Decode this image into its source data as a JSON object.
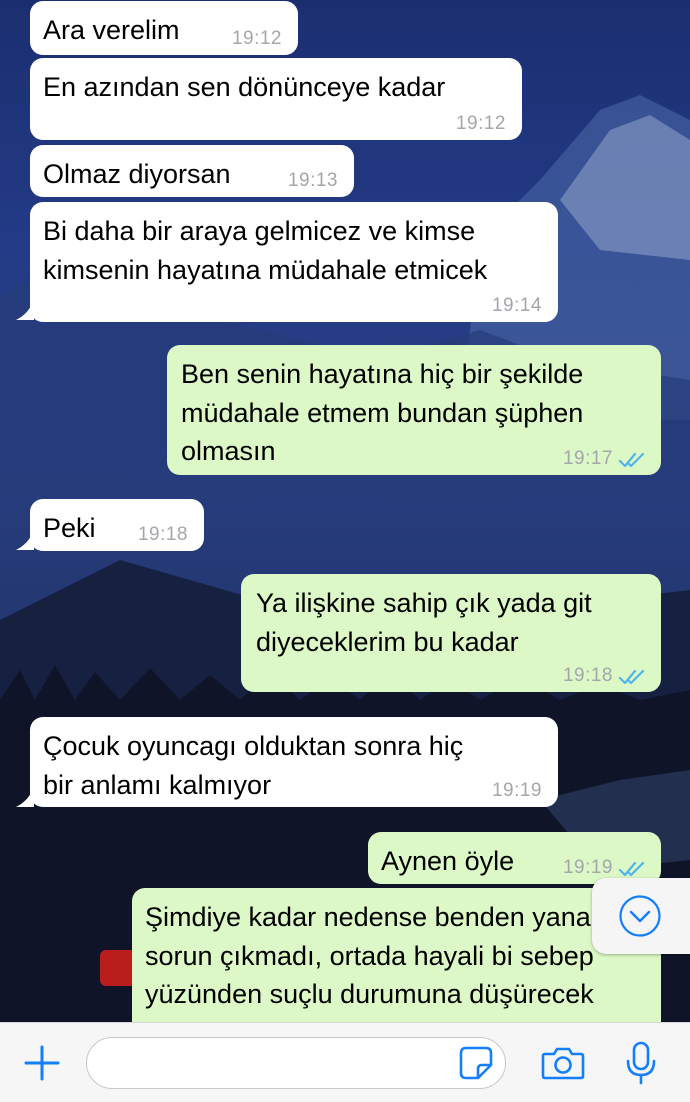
{
  "messages": [
    {
      "text": "Ara verelim",
      "time": "19:12",
      "dir": "in"
    },
    {
      "text": "En azından sen dönünceye kadar",
      "time": "19:12",
      "dir": "in"
    },
    {
      "text": "Olmaz diyorsan",
      "time": "19:13",
      "dir": "in"
    },
    {
      "text": "Bi daha bir araya gelmicez ve kimse kimsenin hayatına müdahale etmicek",
      "time": "19:14",
      "dir": "in"
    },
    {
      "text": "Ben senin hayatına hiç bir şekilde müdahale etmem bundan şüphen olmasın",
      "time": "19:17",
      "dir": "out",
      "status": "read"
    },
    {
      "text": "Peki",
      "time": "19:18",
      "dir": "in"
    },
    {
      "text": "Ya ilişkine sahip çık yada git diyeceklerim bu kadar",
      "time": "19:18",
      "dir": "out",
      "status": "read"
    },
    {
      "text": "Çocuk oyuncagı olduktan sonra hiç bir anlamı kalmıyor",
      "time": "19:19",
      "dir": "in"
    },
    {
      "text": "Aynen öyle",
      "time": "19:19",
      "dir": "out",
      "status": "read"
    },
    {
      "text": "Şimdiye kadar nedense benden yana sorun çıkmadı, ortada hayali bi sebep yüzünden suçlu durumuna düşürecek gerekçe ne",
      "time": "",
      "dir": "out"
    }
  ],
  "composer": {
    "input_value": "",
    "icons": [
      "plus-icon",
      "sticker-icon",
      "camera-icon",
      "microphone-icon"
    ]
  },
  "scroll_button_icon": "chevron-down-icon",
  "colors": {
    "incoming_bubble": "#ffffff",
    "outgoing_bubble": "#dcf8c6",
    "timestamp": "#a3a7ab",
    "read_ticks": "#4fb6ec",
    "accent": "#147efb"
  }
}
